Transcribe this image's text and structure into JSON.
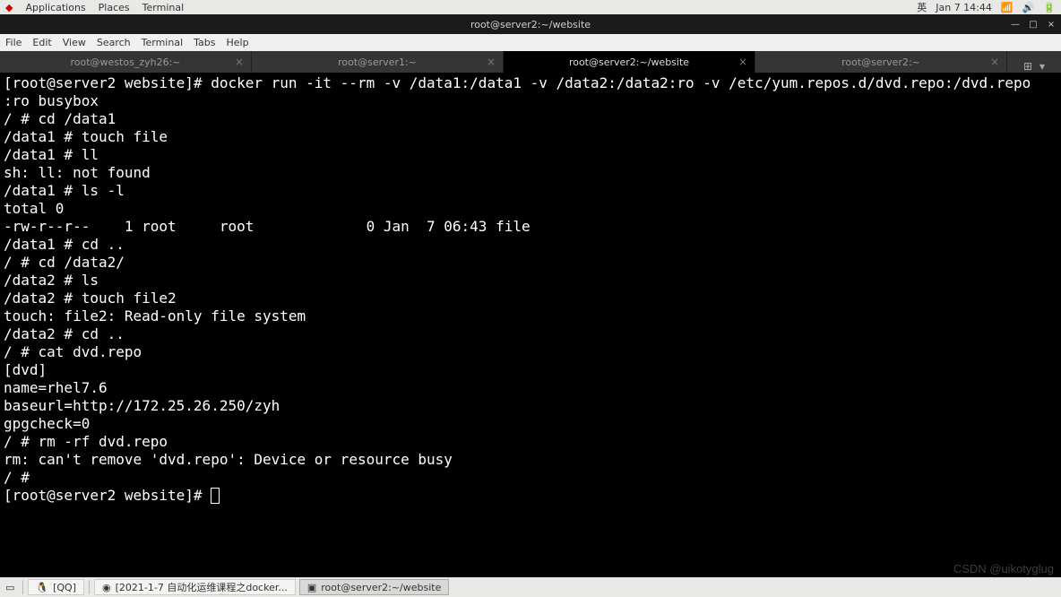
{
  "topbar": {
    "menu": [
      "Applications",
      "Places",
      "Terminal"
    ],
    "ime": "英",
    "date": "Jan 7  14:44",
    "icons": [
      "wifi-icon",
      "volume-icon",
      "battery-icon"
    ]
  },
  "window": {
    "title": "root@server2:~/website",
    "buttons": {
      "min": "—",
      "max": "□",
      "close": "×"
    }
  },
  "menubar": [
    "File",
    "Edit",
    "View",
    "Search",
    "Terminal",
    "Tabs",
    "Help"
  ],
  "tabs": [
    {
      "label": "root@westos_zyh26:~",
      "active": false
    },
    {
      "label": "root@server1:~",
      "active": false
    },
    {
      "label": "root@server2:~/website",
      "active": true
    },
    {
      "label": "root@server2:~",
      "active": false
    }
  ],
  "terminal_lines": [
    "[root@server2 website]# docker run -it --rm -v /data1:/data1 -v /data2:/data2:ro -v /etc/yum.repos.d/dvd.repo:/dvd.repo",
    ":ro busybox",
    "/ # cd /data1",
    "/data1 # touch file",
    "/data1 # ll",
    "sh: ll: not found",
    "/data1 # ls -l",
    "total 0",
    "-rw-r--r--    1 root     root             0 Jan  7 06:43 file",
    "/data1 # cd ..",
    "/ # cd /data2/",
    "/data2 # ls",
    "/data2 # touch file2",
    "touch: file2: Read-only file system",
    "/data2 # cd ..",
    "/ # cat dvd.repo",
    "[dvd]",
    "name=rhel7.6",
    "baseurl=http://172.25.26.250/zyh",
    "gpgcheck=0",
    "/ # rm -rf dvd.repo",
    "rm: can't remove 'dvd.repo': Device or resource busy",
    "/ #",
    "[root@server2 website]# "
  ],
  "taskbar": {
    "items": [
      {
        "icon": "qq-icon",
        "label": "[QQ]"
      },
      {
        "icon": "chrome-icon",
        "label": "[2021-1-7 自动化运维课程之docker..."
      },
      {
        "icon": "terminal-icon",
        "label": "root@server2:~/website",
        "active": true
      }
    ]
  },
  "watermark": "CSDN @uikotyglug"
}
